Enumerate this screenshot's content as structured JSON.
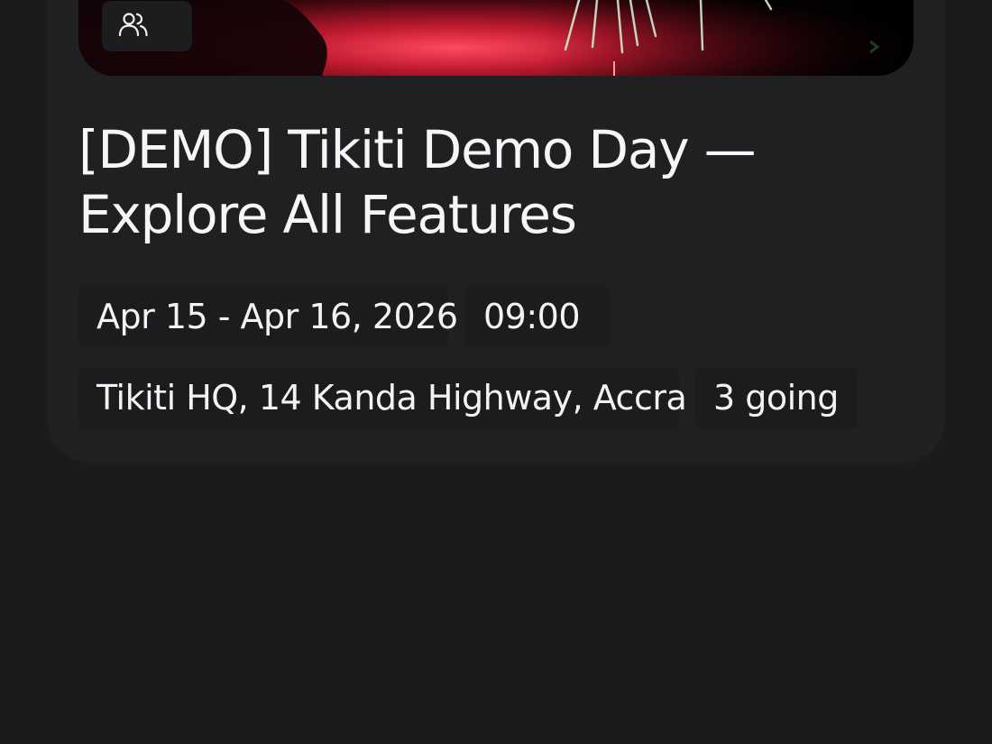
{
  "event": {
    "title_line1": "[DEMO] Tikiti Demo Day —",
    "title_line2": "Explore All Features",
    "date_range": "Apr 15 - Apr 16, 2026",
    "time": "09:00",
    "venue": "Tikiti HQ, 14 Kanda Highway, Accra",
    "attendance": "3 going"
  },
  "icons": {
    "attendees": "users-icon"
  },
  "colors": {
    "background": "#1b1a1d",
    "card": "#201f22",
    "chip": "#1c1b1e",
    "text": "#f5f4f6",
    "hero_red": "#d6283c"
  }
}
